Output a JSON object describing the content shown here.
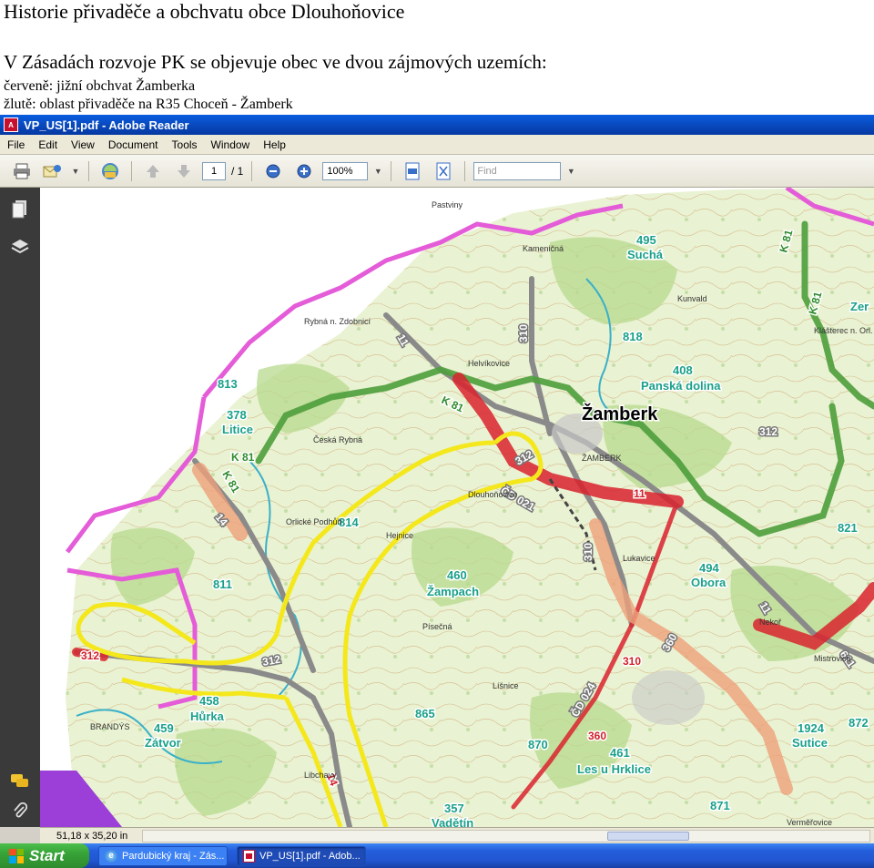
{
  "slide": {
    "title": "Historie přivaděče a obchvatu obce Dlouhoňovice",
    "line1": "V Zásadách rozvoje PK se objevuje obec ve dvou zájmových uzemích:",
    "line2": "červeně: jižní obchvat Žamberka",
    "line3": "žlutě: oblast přivaděče na R35 Choceň - Žamberk"
  },
  "window": {
    "title": "VP_US[1].pdf - Adobe Reader",
    "menu": [
      "File",
      "Edit",
      "View",
      "Document",
      "Tools",
      "Window",
      "Help"
    ]
  },
  "toolbar": {
    "page_current": "1",
    "page_sep": "/ 1",
    "zoom": "100%",
    "find_placeholder": "Find"
  },
  "map": {
    "place_labels": [
      {
        "text": "495",
        "color": "#1aa08a"
      },
      {
        "text": "Suchá",
        "color": "#1aa08a"
      },
      {
        "text": "818",
        "color": "#1aa08a"
      },
      {
        "text": "408",
        "color": "#1aa08a"
      },
      {
        "text": "Panská dolina",
        "color": "#1aa08a"
      },
      {
        "text": "Žamberk",
        "color": "#000000"
      },
      {
        "text": "813",
        "color": "#1aa08a"
      },
      {
        "text": "378",
        "color": "#1aa08a"
      },
      {
        "text": "Litice",
        "color": "#1aa08a"
      },
      {
        "text": "814",
        "color": "#1aa08a"
      },
      {
        "text": "811",
        "color": "#1aa08a"
      },
      {
        "text": "460",
        "color": "#1aa08a"
      },
      {
        "text": "Žampach",
        "color": "#1aa08a"
      },
      {
        "text": "494",
        "color": "#1aa08a"
      },
      {
        "text": "Obora",
        "color": "#1aa08a"
      },
      {
        "text": "458",
        "color": "#1aa08a"
      },
      {
        "text": "Hůrka",
        "color": "#1aa08a"
      },
      {
        "text": "459",
        "color": "#1aa08a"
      },
      {
        "text": "Zátvor",
        "color": "#1aa08a"
      },
      {
        "text": "865",
        "color": "#1aa08a"
      },
      {
        "text": "870",
        "color": "#1aa08a"
      },
      {
        "text": "461",
        "color": "#1aa08a"
      },
      {
        "text": "Les u Hrklice",
        "color": "#1aa08a"
      },
      {
        "text": "357",
        "color": "#1aa08a"
      },
      {
        "text": "Vadětín",
        "color": "#1aa08a"
      },
      {
        "text": "871",
        "color": "#1aa08a"
      },
      {
        "text": "1924",
        "color": "#1aa08a"
      },
      {
        "text": "Sutice",
        "color": "#1aa08a"
      },
      {
        "text": "872",
        "color": "#1aa08a"
      },
      {
        "text": "821",
        "color": "#1aa08a"
      },
      {
        "text": "Zer",
        "color": "#1aa08a"
      }
    ],
    "road_labels": [
      {
        "text": "K 81",
        "color": "#2e8b2e"
      },
      {
        "text": "K 81",
        "color": "#2e8b2e"
      },
      {
        "text": "K 81",
        "color": "#2e8b2e"
      },
      {
        "text": "K 81",
        "color": "#2e8b2e"
      },
      {
        "text": "K 81",
        "color": "#2e8b2e"
      },
      {
        "text": "11",
        "color": "#ffffff"
      },
      {
        "text": "310",
        "color": "#ffffff"
      },
      {
        "text": "312",
        "color": "#ffffff"
      },
      {
        "text": "312",
        "color": "#ffffff"
      },
      {
        "text": "312",
        "color": "#ffffff"
      },
      {
        "text": "ČD 021",
        "color": "#ffffff"
      },
      {
        "text": "11",
        "color": "#d0202a"
      },
      {
        "text": "310",
        "color": "#ffffff"
      },
      {
        "text": "360",
        "color": "#ffffff"
      },
      {
        "text": "310",
        "color": "#d0202a"
      },
      {
        "text": "ČD 024",
        "color": "#ffffff"
      },
      {
        "text": "360",
        "color": "#d0202a"
      },
      {
        "text": "312",
        "color": "#d0202a"
      },
      {
        "text": "14",
        "color": "#ffffff"
      },
      {
        "text": "14",
        "color": "#d0202a"
      },
      {
        "text": "11",
        "color": "#ffffff"
      },
      {
        "text": "611",
        "color": "#ffffff"
      }
    ],
    "small_labels": [
      "Helvíkovice",
      "Kunvald",
      "ŽAMBERK",
      "Lukavice",
      "Dlouhoňovice",
      "Kameničná",
      "Rybná n. Zdobnicí",
      "Pastviny",
      "Verměřovice",
      "Písečná",
      "Líšnice",
      "Nekoř",
      "Mistrovice",
      "BRANDÝS",
      "Libchavy",
      "Česká Rybná",
      "Klášterec n. Orl.",
      "Hejnice",
      "Orlické Podhůří"
    ]
  },
  "status": {
    "size": "51,18 x 35,20 in"
  },
  "taskbar": {
    "start": "Start",
    "items": [
      {
        "label": "Pardubický kraj - Zás...",
        "active": false
      },
      {
        "label": "VP_US[1].pdf - Adob...",
        "active": true
      }
    ]
  },
  "colors": {
    "pink_boundary": "#e45cd8",
    "green_corridor": "#4e9e3c",
    "red_corridor": "#d9232e",
    "salmon_corridor": "#eea07a",
    "yellow_area": "#f4e81c"
  }
}
